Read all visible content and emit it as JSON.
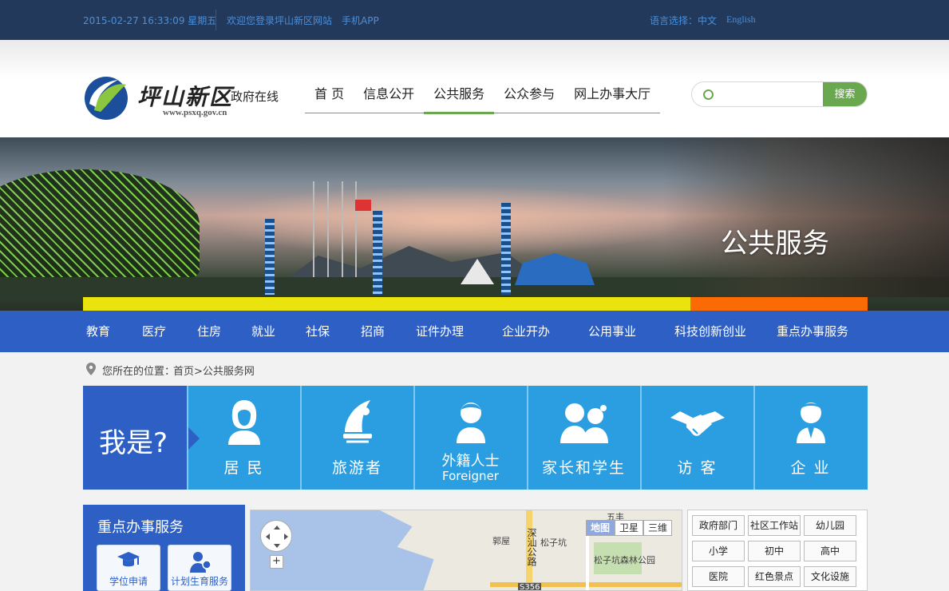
{
  "topbar": {
    "datetime": "2015-02-27 16:33:09 星期五",
    "welcome": "欢迎您登录坪山新区网站",
    "app": "手机APP",
    "lang_label": "语言选择：",
    "lang_cn": "中文",
    "lang_en": "English"
  },
  "logo": {
    "name": "坪山新区",
    "sub": "政府在线",
    "url": "www.psxq.gov.cn"
  },
  "mainnav": {
    "items": [
      {
        "label": "首 页"
      },
      {
        "label": "信息公开"
      },
      {
        "label": "公共服务"
      },
      {
        "label": "公众参与"
      },
      {
        "label": "网上办事大厅"
      }
    ]
  },
  "search": {
    "placeholder": "",
    "button": "搜索"
  },
  "banner": {
    "title": "公共服务"
  },
  "catnav": {
    "items": [
      "教育",
      "医疗",
      "住房",
      "就业",
      "社保",
      "招商",
      "证件办理",
      "企业开办",
      "公用事业",
      "科技创新创业",
      "重点办事服务"
    ]
  },
  "breadcrumb": {
    "label": "您所在的位置：",
    "path": "首页>公共服务网"
  },
  "whoami": {
    "prompt": "我是?",
    "tiles": [
      {
        "label": "居 民",
        "icon": "resident-icon"
      },
      {
        "label": "旅游者",
        "icon": "tourist-icon"
      },
      {
        "label": "外籍人士",
        "sub": "Foreigner",
        "icon": "foreigner-icon"
      },
      {
        "label": "家长和学生",
        "icon": "parents-students-icon"
      },
      {
        "label": "访 客",
        "icon": "handshake-icon"
      },
      {
        "label": "企 业",
        "icon": "business-icon"
      }
    ]
  },
  "keyservices": {
    "title": "重点办事服务",
    "items": [
      {
        "label": "学位申请",
        "icon": "graduation-cap-icon"
      },
      {
        "label": "计划生育服务",
        "icon": "family-planning-icon"
      }
    ]
  },
  "map": {
    "types": [
      "地图",
      "卫星",
      "三维"
    ],
    "active_type": "地图",
    "labels": {
      "guowu": "郭屋",
      "songzikeng": "松子坑",
      "wufeng": "五丰",
      "park": "松子坑森林公园",
      "road": "深汕公路",
      "s356": "S356"
    }
  },
  "facilities": {
    "items": [
      "政府部门",
      "社区工作站",
      "幼儿园",
      "小学",
      "初中",
      "高中",
      "医院",
      "红色景点",
      "文化设施"
    ]
  }
}
